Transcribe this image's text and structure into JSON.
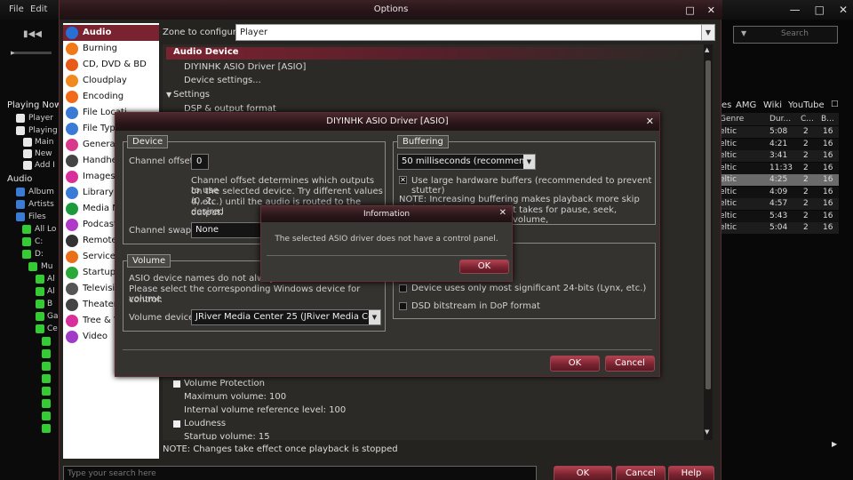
{
  "menubar": {
    "file": "File",
    "edit": "Edit"
  },
  "bg_tree": {
    "playing_now": "Playing Now",
    "player": "Player",
    "playing": "Playing",
    "main": "Main",
    "new": "New",
    "add": "Add I",
    "audio": "Audio",
    "album": "Album",
    "artists": "Artists",
    "files": "Files",
    "all_lo": "All Lo",
    "c": "C:",
    "d": "D:",
    "mu": "Mu",
    "al1": "Al",
    "al2": "Al",
    "b": "B",
    "ga": "Ga",
    "ce": "Ce"
  },
  "top_search": {
    "placeholder": "Search"
  },
  "right_tabs": {
    "es": "es",
    "amg": "AMG",
    "wiki": "Wiki",
    "youtube": "YouTube"
  },
  "right_headers": {
    "genre": "Genre",
    "duration": "Dur...",
    "c": "C...",
    "b": "B..."
  },
  "right_rows": [
    {
      "genre": "eltic",
      "dur": "5:08",
      "c": "2",
      "b": "16"
    },
    {
      "genre": "eltic",
      "dur": "4:21",
      "c": "2",
      "b": "16"
    },
    {
      "genre": "eltic",
      "dur": "3:41",
      "c": "2",
      "b": "16"
    },
    {
      "genre": "eltic",
      "dur": "11:33",
      "c": "2",
      "b": "16"
    },
    {
      "genre": "eltic",
      "dur": "4:25",
      "c": "2",
      "b": "16"
    },
    {
      "genre": "eltic",
      "dur": "4:09",
      "c": "2",
      "b": "16"
    },
    {
      "genre": "eltic",
      "dur": "4:57",
      "c": "2",
      "b": "16"
    },
    {
      "genre": "eltic",
      "dur": "5:43",
      "c": "2",
      "b": "16"
    },
    {
      "genre": "eltic",
      "dur": "5:04",
      "c": "2",
      "b": "16"
    }
  ],
  "options": {
    "title": "Options",
    "zone_label": "Zone to configure:",
    "zone_value": "Player",
    "sidebar": [
      {
        "label": "Audio",
        "color": "#2a6fd6"
      },
      {
        "label": "Burning",
        "color": "#f07a1a"
      },
      {
        "label": "CD, DVD & BD",
        "color": "#e85a1a"
      },
      {
        "label": "Cloudplay",
        "color": "#f08a20"
      },
      {
        "label": "Encoding",
        "color": "#f06a1a"
      },
      {
        "label": "File Locati",
        "color": "#3a7bd5"
      },
      {
        "label": "File Type",
        "color": "#3a7bd5"
      },
      {
        "label": "General",
        "color": "#d83a8a"
      },
      {
        "label": "Handhel",
        "color": "#444444"
      },
      {
        "label": "Images",
        "color": "#d8309a"
      },
      {
        "label": "Library &",
        "color": "#3a7bd5"
      },
      {
        "label": "Media N",
        "color": "#1a9a3a"
      },
      {
        "label": "Podcast",
        "color": "#b03ac8"
      },
      {
        "label": "Remote",
        "color": "#333333"
      },
      {
        "label": "Services",
        "color": "#e8701a"
      },
      {
        "label": "Startup",
        "color": "#2aa83a"
      },
      {
        "label": "Televisic",
        "color": "#555555"
      },
      {
        "label": "Theater",
        "color": "#444444"
      },
      {
        "label": "Tree & V",
        "color": "#d8309a"
      },
      {
        "label": "Video",
        "color": "#a03ac8"
      }
    ],
    "audio_device_header": "Audio Device",
    "device_name": "DIYINHK ASIO Driver [ASIO]",
    "device_settings": "Device settings...",
    "settings_header": "Settings",
    "dsp": "DSP & output format",
    "volume_protection": "Volume Protection",
    "max_volume": "Maximum volume: 100",
    "internal_volume": "Internal volume reference level: 100",
    "loudness": "Loudness",
    "startup_volume": "Startup volume: 15",
    "note": "NOTE: Changes take effect once playback is stopped",
    "search_placeholder": "Type your search here",
    "ok": "OK",
    "cancel": "Cancel",
    "help": "Help"
  },
  "asio": {
    "title": "DIYINHK ASIO Driver [ASIO]",
    "device_group": "Device",
    "channel_offset_label": "Channel offset:",
    "channel_offset_value": "0",
    "channel_offset_help_1": "Channel offset determines which outputs to use",
    "channel_offset_help_2": "on the selected device.  Try different values (0, 2,",
    "channel_offset_help_3": "4, etc.) until the audio is routed to the desired",
    "channel_offset_help_4": "output.",
    "channel_swap_label": "Channel swap:",
    "channel_swap_value": "None",
    "buffering_group": "Buffering",
    "buffer_value": "50 milliseconds (recommended)",
    "large_buffers": "Use large hardware buffers (recommended to prevent stutter)",
    "buffer_note_1": "NOTE: Increasing buffering makes playback more skip resistant, but",
    "buffer_note_2": "t takes for pause, seek, volume,",
    "volume_group": "Volume",
    "volume_help_1": "ASIO device names do not always m",
    "volume_help_2": "Please select the corresponding Windows device for volume",
    "volume_help_3": "control.",
    "volume_device_label": "Volume device:",
    "volume_device_value": "JRiver Media Center 25 (JRiver Media Center...",
    "msb_24": "Device uses only most significant 24-bits (Lynx, etc.)",
    "dsd": "DSD bitstream in DoP format",
    "ok": "OK",
    "cancel": "Cancel"
  },
  "info": {
    "title": "Information",
    "message": "The selected ASIO driver does not have a control panel.",
    "ok": "OK"
  }
}
